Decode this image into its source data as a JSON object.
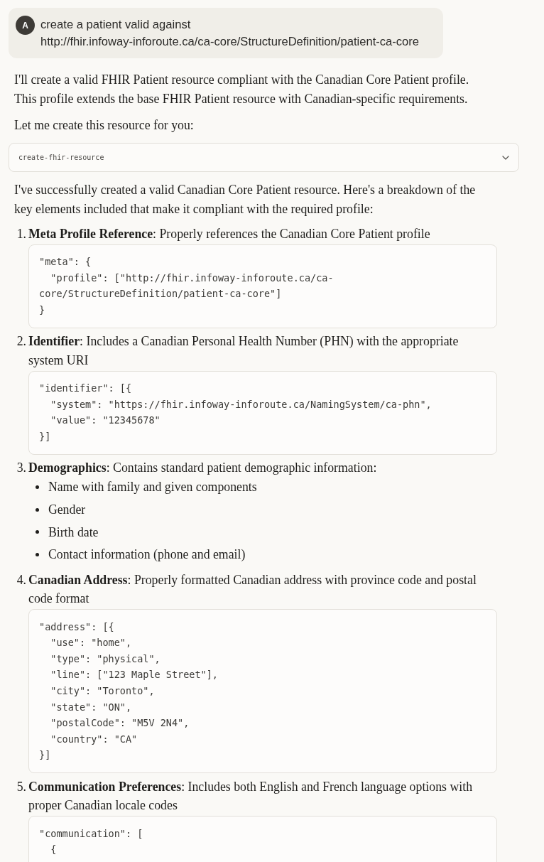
{
  "user_message": {
    "avatar": "A",
    "text": "create a patient valid against http://fhir.infoway-inforoute.ca/ca-core/StructureDefinition/patient-ca-core"
  },
  "intro": [
    "I'll create a valid FHIR Patient resource compliant with the Canadian Core Patient profile. This profile extends the base FHIR Patient resource with Canadian-specific requirements.",
    "Let me create this resource for you:"
  ],
  "tool_call": {
    "name": "create-fhir-resource",
    "expanded": false
  },
  "summary": "I've successfully created a valid Canadian Core Patient resource. Here's a breakdown of the key elements included that make it compliant with the required profile:",
  "items": [
    {
      "kind": "code",
      "number": "1.",
      "text": "**Meta Profile Reference**: Properly references the Canadian Core Patient profile",
      "code": [
        "\"meta\": {",
        "  \"profile\": [\"http://fhir.infoway-inforoute.ca/ca-core/StructureDefinition/patient-ca-core\"]",
        "}"
      ]
    },
    {
      "kind": "code",
      "number": "2.",
      "text": "**Identifier**: Includes a Canadian Personal Health Number (PHN) with the appropriate system URI",
      "code": [
        "\"identifier\": [{",
        "  \"system\": \"https://fhir.infoway-inforoute.ca/NamingSystem/ca-phn\",",
        "  \"value\": \"12345678\"",
        "}]"
      ]
    },
    {
      "kind": "bullets",
      "number": "3.",
      "text": "**Demographics**: Contains standard patient demographic information:",
      "bullets": [
        "Name with family and given components",
        "Gender",
        "Birth date",
        "Contact information (phone and email)"
      ]
    },
    {
      "kind": "code",
      "number": "4.",
      "text": "**Canadian Address**: Properly formatted Canadian address with province code and postal code format",
      "code": [
        "\"address\": [{",
        "  \"use\": \"home\",",
        "  \"type\": \"physical\",",
        "  \"line\": [\"123 Maple Street\"],",
        "  \"city\": \"Toronto\",",
        "  \"state\": \"ON\",",
        "  \"postalCode\": \"M5V 2N4\",",
        "  \"country\": \"CA\"",
        "}]"
      ]
    },
    {
      "kind": "code",
      "number": "5.",
      "text": "**Communication Preferences**: Includes both English and French language options with proper Canadian locale codes",
      "code": [
        "\"communication\": [",
        "  {"
      ]
    }
  ]
}
